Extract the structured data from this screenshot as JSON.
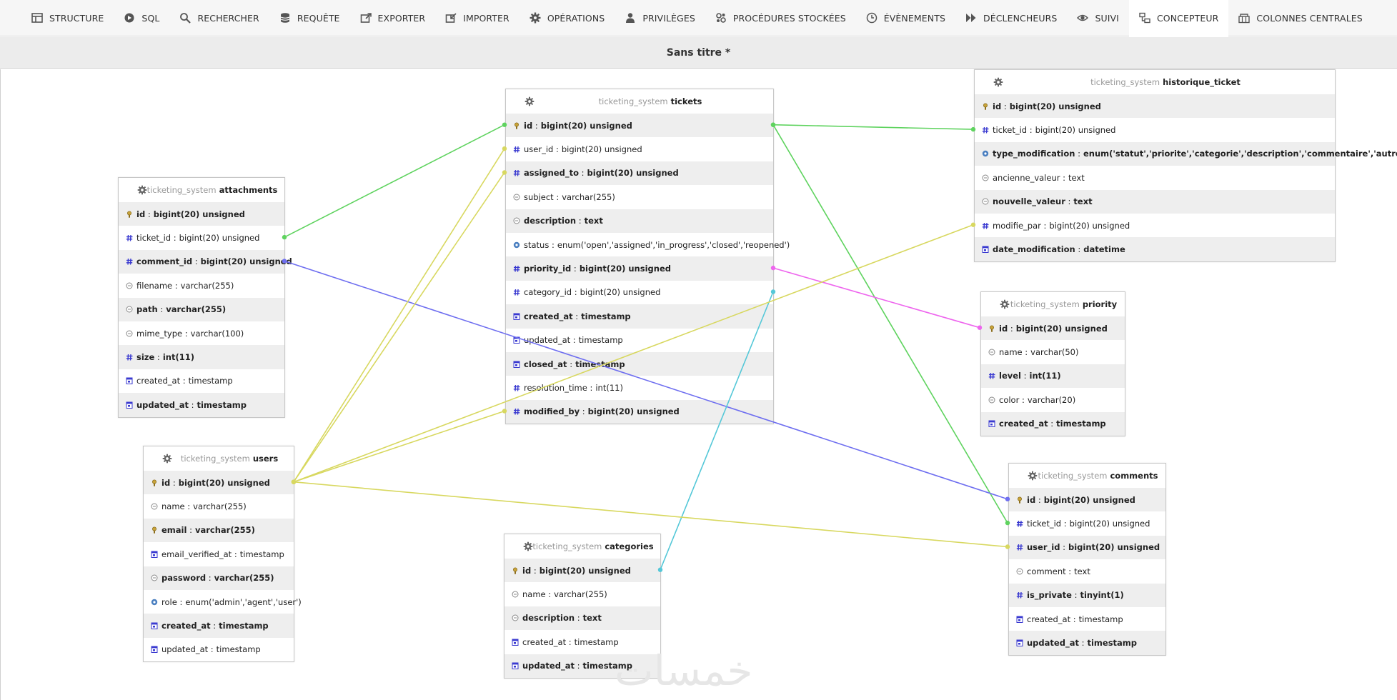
{
  "nav": {
    "items": [
      {
        "label": "Structure",
        "icon": "structure-icon"
      },
      {
        "label": "SQL",
        "icon": "sql-icon"
      },
      {
        "label": "Rechercher",
        "icon": "search-icon"
      },
      {
        "label": "Requête",
        "icon": "database-icon"
      },
      {
        "label": "Exporter",
        "icon": "export-icon"
      },
      {
        "label": "Importer",
        "icon": "import-icon"
      },
      {
        "label": "Opérations",
        "icon": "gear-icon"
      },
      {
        "label": "Privilèges",
        "icon": "user-icon"
      },
      {
        "label": "Procédures stockées",
        "icon": "routines-icon"
      },
      {
        "label": "Évènements",
        "icon": "clock-icon"
      },
      {
        "label": "Déclencheurs",
        "icon": "trigger-icon"
      },
      {
        "label": "Suivi",
        "icon": "eye-icon"
      },
      {
        "label": "Concepteur",
        "icon": "designer-icon",
        "active": true
      },
      {
        "label": "Colonnes centrales",
        "icon": "central-columns-icon"
      }
    ]
  },
  "designer": {
    "title": "Sans titre *",
    "database": "ticketing_system",
    "tables": [
      {
        "name": "attachments",
        "columns": [
          {
            "name": "id",
            "type": "bigint(20) unsigned",
            "icon": "key",
            "bold": true
          },
          {
            "name": "ticket_id",
            "type": "bigint(20) unsigned",
            "icon": "number",
            "bold": false
          },
          {
            "name": "comment_id",
            "type": "bigint(20) unsigned",
            "icon": "number",
            "bold": true
          },
          {
            "name": "filename",
            "type": "varchar(255)",
            "icon": "text",
            "bold": false
          },
          {
            "name": "path",
            "type": "varchar(255)",
            "icon": "text",
            "bold": true
          },
          {
            "name": "mime_type",
            "type": "varchar(100)",
            "icon": "text",
            "bold": false
          },
          {
            "name": "size",
            "type": "int(11)",
            "icon": "number",
            "bold": true
          },
          {
            "name": "created_at",
            "type": "timestamp",
            "icon": "date",
            "bold": false
          },
          {
            "name": "updated_at",
            "type": "timestamp",
            "icon": "date",
            "bold": true
          }
        ]
      },
      {
        "name": "tickets",
        "columns": [
          {
            "name": "id",
            "type": "bigint(20) unsigned",
            "icon": "key",
            "bold": true
          },
          {
            "name": "user_id",
            "type": "bigint(20) unsigned",
            "icon": "number",
            "bold": false
          },
          {
            "name": "assigned_to",
            "type": "bigint(20) unsigned",
            "icon": "number",
            "bold": true
          },
          {
            "name": "subject",
            "type": "varchar(255)",
            "icon": "text",
            "bold": false
          },
          {
            "name": "description",
            "type": "text",
            "icon": "text",
            "bold": true
          },
          {
            "name": "status",
            "type": "enum('open','assigned','in_progress','closed','reopened')",
            "icon": "enum",
            "bold": false
          },
          {
            "name": "priority_id",
            "type": "bigint(20) unsigned",
            "icon": "number",
            "bold": true
          },
          {
            "name": "category_id",
            "type": "bigint(20) unsigned",
            "icon": "number",
            "bold": false
          },
          {
            "name": "created_at",
            "type": "timestamp",
            "icon": "date",
            "bold": true
          },
          {
            "name": "updated_at",
            "type": "timestamp",
            "icon": "date",
            "bold": false
          },
          {
            "name": "closed_at",
            "type": "timestamp",
            "icon": "date",
            "bold": true
          },
          {
            "name": "resolution_time",
            "type": "int(11)",
            "icon": "number",
            "bold": false
          },
          {
            "name": "modified_by",
            "type": "bigint(20) unsigned",
            "icon": "number",
            "bold": true
          }
        ]
      },
      {
        "name": "historique_ticket",
        "columns": [
          {
            "name": "id",
            "type": "bigint(20) unsigned",
            "icon": "key",
            "bold": true
          },
          {
            "name": "ticket_id",
            "type": "bigint(20) unsigned",
            "icon": "number",
            "bold": false
          },
          {
            "name": "type_modification",
            "type": "enum('statut','priorite','categorie','description','commentaire','autre')",
            "icon": "enum",
            "bold": true
          },
          {
            "name": "ancienne_valeur",
            "type": "text",
            "icon": "text",
            "bold": false
          },
          {
            "name": "nouvelle_valeur",
            "type": "text",
            "icon": "text",
            "bold": true
          },
          {
            "name": "modifie_par",
            "type": "bigint(20) unsigned",
            "icon": "number",
            "bold": false
          },
          {
            "name": "date_modification",
            "type": "datetime",
            "icon": "date",
            "bold": true
          }
        ]
      },
      {
        "name": "priority",
        "columns": [
          {
            "name": "id",
            "type": "bigint(20) unsigned",
            "icon": "key",
            "bold": true
          },
          {
            "name": "name",
            "type": "varchar(50)",
            "icon": "text",
            "bold": false
          },
          {
            "name": "level",
            "type": "int(11)",
            "icon": "number",
            "bold": true
          },
          {
            "name": "color",
            "type": "varchar(20)",
            "icon": "text",
            "bold": false
          },
          {
            "name": "created_at",
            "type": "timestamp",
            "icon": "date",
            "bold": true
          }
        ]
      },
      {
        "name": "users",
        "columns": [
          {
            "name": "id",
            "type": "bigint(20) unsigned",
            "icon": "key",
            "bold": true
          },
          {
            "name": "name",
            "type": "varchar(255)",
            "icon": "text",
            "bold": false
          },
          {
            "name": "email",
            "type": "varchar(255)",
            "icon": "key",
            "bold": true
          },
          {
            "name": "email_verified_at",
            "type": "timestamp",
            "icon": "date",
            "bold": false
          },
          {
            "name": "password",
            "type": "varchar(255)",
            "icon": "text",
            "bold": true
          },
          {
            "name": "role",
            "type": "enum('admin','agent','user')",
            "icon": "enum",
            "bold": false
          },
          {
            "name": "created_at",
            "type": "timestamp",
            "icon": "date",
            "bold": true
          },
          {
            "name": "updated_at",
            "type": "timestamp",
            "icon": "date",
            "bold": false
          }
        ]
      },
      {
        "name": "categories",
        "columns": [
          {
            "name": "id",
            "type": "bigint(20) unsigned",
            "icon": "key",
            "bold": true
          },
          {
            "name": "name",
            "type": "varchar(255)",
            "icon": "text",
            "bold": false
          },
          {
            "name": "description",
            "type": "text",
            "icon": "text",
            "bold": true
          },
          {
            "name": "created_at",
            "type": "timestamp",
            "icon": "date",
            "bold": false
          },
          {
            "name": "updated_at",
            "type": "timestamp",
            "icon": "date",
            "bold": true
          }
        ]
      },
      {
        "name": "comments",
        "columns": [
          {
            "name": "id",
            "type": "bigint(20) unsigned",
            "icon": "key",
            "bold": true
          },
          {
            "name": "ticket_id",
            "type": "bigint(20) unsigned",
            "icon": "number",
            "bold": false
          },
          {
            "name": "user_id",
            "type": "bigint(20) unsigned",
            "icon": "number",
            "bold": true
          },
          {
            "name": "comment",
            "type": "text",
            "icon": "text",
            "bold": false
          },
          {
            "name": "is_private",
            "type": "tinyint(1)",
            "icon": "number",
            "bold": true
          },
          {
            "name": "created_at",
            "type": "timestamp",
            "icon": "date",
            "bold": false
          },
          {
            "name": "updated_at",
            "type": "timestamp",
            "icon": "date",
            "bold": true
          }
        ]
      }
    ],
    "relations": [
      {
        "from": "tickets.id",
        "to": "attachments.ticket_id",
        "color": "#5fd35f"
      },
      {
        "from": "tickets.id",
        "to": "historique_ticket.ticket_id",
        "color": "#5fd35f"
      },
      {
        "from": "tickets.id",
        "to": "comments.ticket_id",
        "color": "#5fd35f"
      },
      {
        "from": "comments.id",
        "to": "attachments.comment_id",
        "color": "#6f6ff0"
      },
      {
        "from": "priority.id",
        "to": "tickets.priority_id",
        "color": "#ee66ee"
      },
      {
        "from": "categories.id",
        "to": "tickets.category_id",
        "color": "#55c8d8"
      },
      {
        "from": "users.id",
        "to": "tickets.user_id",
        "color": "#d8d860"
      },
      {
        "from": "users.id",
        "to": "tickets.assigned_to",
        "color": "#d8d860"
      },
      {
        "from": "users.id",
        "to": "tickets.modified_by",
        "color": "#d8d860"
      },
      {
        "from": "users.id",
        "to": "historique_ticket.modifie_par",
        "color": "#d8d860"
      },
      {
        "from": "users.id",
        "to": "comments.user_id",
        "color": "#d8d860"
      }
    ]
  },
  "watermark": "خمسات"
}
